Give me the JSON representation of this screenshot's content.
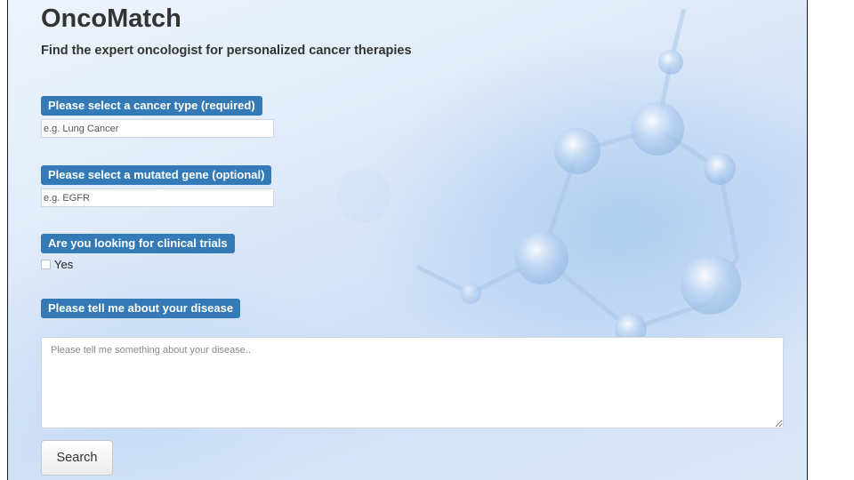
{
  "app": {
    "title": "OncoMatch",
    "subtitle": "Find the expert oncologist for personalized cancer therapies"
  },
  "form": {
    "cancer_type": {
      "label": "Please select a cancer type (required)",
      "placeholder": "e.g. Lung Cancer",
      "value": ""
    },
    "mutated_gene": {
      "label": "Please select a mutated gene (optional)",
      "placeholder": "e.g. EGFR",
      "value": ""
    },
    "clinical_trials": {
      "label": "Are you looking for clinical trials",
      "option_label": "Yes",
      "checked": false
    },
    "disease": {
      "label": "Please tell me about your disease",
      "placeholder": "Please tell me something about your disease..",
      "value": ""
    },
    "search_label": "Search"
  },
  "theme": {
    "label_bg": "#337ab7",
    "label_text": "#ffffff",
    "title_color": "#333333"
  }
}
